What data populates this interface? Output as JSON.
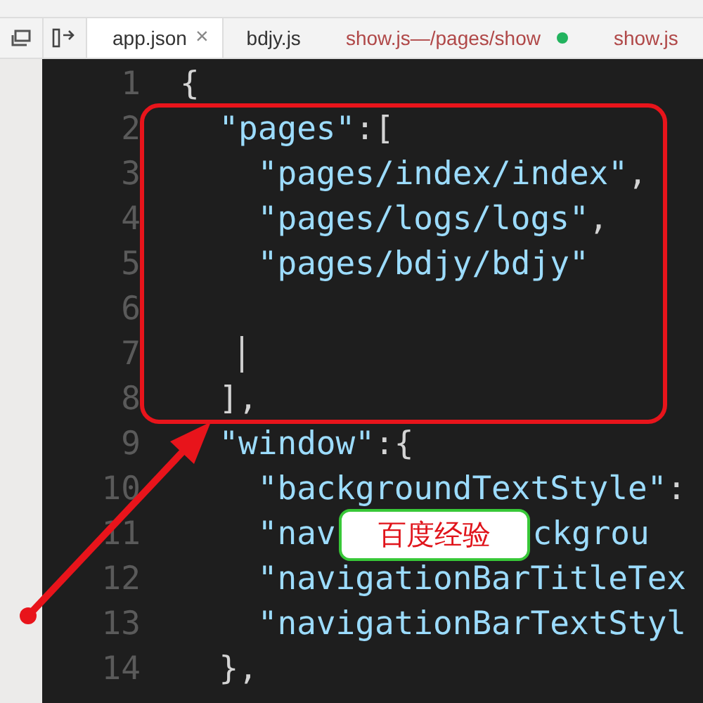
{
  "tabs": [
    {
      "label": "app.json",
      "selected": true,
      "deleted": false,
      "modified": false,
      "close": "×"
    },
    {
      "label": "bdjy.js",
      "selected": false,
      "deleted": false,
      "modified": false
    },
    {
      "label": "show.js",
      "path": " —/pages/show",
      "selected": false,
      "deleted": true,
      "modified": true
    },
    {
      "label": "show.js",
      "selected": false,
      "deleted": true,
      "modified": false
    }
  ],
  "editor": {
    "lines": [
      {
        "number": "1",
        "cursor": false,
        "segments": [
          {
            "kind": "punct",
            "text": "{"
          }
        ]
      },
      {
        "number": "2",
        "cursor": false,
        "segments": [
          {
            "kind": "string",
            "text": "  \"pages\""
          },
          {
            "kind": "punct",
            "text": ":["
          }
        ]
      },
      {
        "number": "3",
        "cursor": false,
        "segments": [
          {
            "kind": "string",
            "text": "    \"pages/index/index\""
          },
          {
            "kind": "punct",
            "text": ","
          }
        ]
      },
      {
        "number": "4",
        "cursor": false,
        "segments": [
          {
            "kind": "string",
            "text": "    \"pages/logs/logs\""
          },
          {
            "kind": "punct",
            "text": ","
          }
        ]
      },
      {
        "number": "5",
        "cursor": false,
        "segments": [
          {
            "kind": "string",
            "text": "    \"pages/bdjy/bdjy\""
          }
        ]
      },
      {
        "number": "6",
        "cursor": false
      },
      {
        "number": "7",
        "cursor": true
      },
      {
        "number": "8",
        "cursor": false,
        "segments": [
          {
            "kind": "punct",
            "text": "  ],"
          }
        ]
      },
      {
        "number": "9",
        "cursor": false,
        "segments": [
          {
            "kind": "string",
            "text": "  \"window\""
          },
          {
            "kind": "punct",
            "text": ":{"
          }
        ]
      },
      {
        "number": "10",
        "cursor": false,
        "segments": [
          {
            "kind": "string",
            "text": "    \"backgroundTextStyle\""
          },
          {
            "kind": "punct",
            "text": ":"
          }
        ]
      },
      {
        "number": "11",
        "cursor": false,
        "segments": [
          {
            "kind": "string",
            "text": "    \"nav"
          },
          {
            "kind": "callout",
            "text": "百度经验"
          },
          {
            "kind": "string",
            "text": "ckgrou"
          }
        ]
      },
      {
        "number": "12",
        "cursor": false,
        "segments": [
          {
            "kind": "string",
            "text": "    \"navigationBarTitleTex"
          }
        ]
      },
      {
        "number": "13",
        "cursor": false,
        "segments": [
          {
            "kind": "string",
            "text": "    \"navigationBarTextStyl"
          }
        ]
      },
      {
        "number": "14",
        "cursor": false,
        "segments": [
          {
            "kind": "punct",
            "text": "  },"
          }
        ]
      }
    ]
  }
}
